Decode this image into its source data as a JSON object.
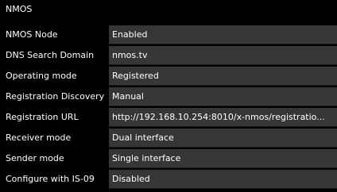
{
  "panel": {
    "title": "NMOS"
  },
  "rows": [
    {
      "label": "NMOS Node",
      "value": "Enabled"
    },
    {
      "label": "DNS Search Domain",
      "value": "nmos.tv"
    },
    {
      "label": "Operating mode",
      "value": "Registered"
    },
    {
      "label": "Registration Discovery",
      "value": "Manual"
    },
    {
      "label": "Registration URL",
      "value": "http://192.168.10.254:8010/x-nmos/registratio..."
    },
    {
      "label": "Receiver mode",
      "value": "Dual interface"
    },
    {
      "label": "Sender mode",
      "value": "Single interface"
    },
    {
      "label": "Configure with IS-09",
      "value": "Disabled"
    }
  ],
  "colors": {
    "background": "#000000",
    "value_cell": "#363636",
    "text": "#ffffff"
  }
}
